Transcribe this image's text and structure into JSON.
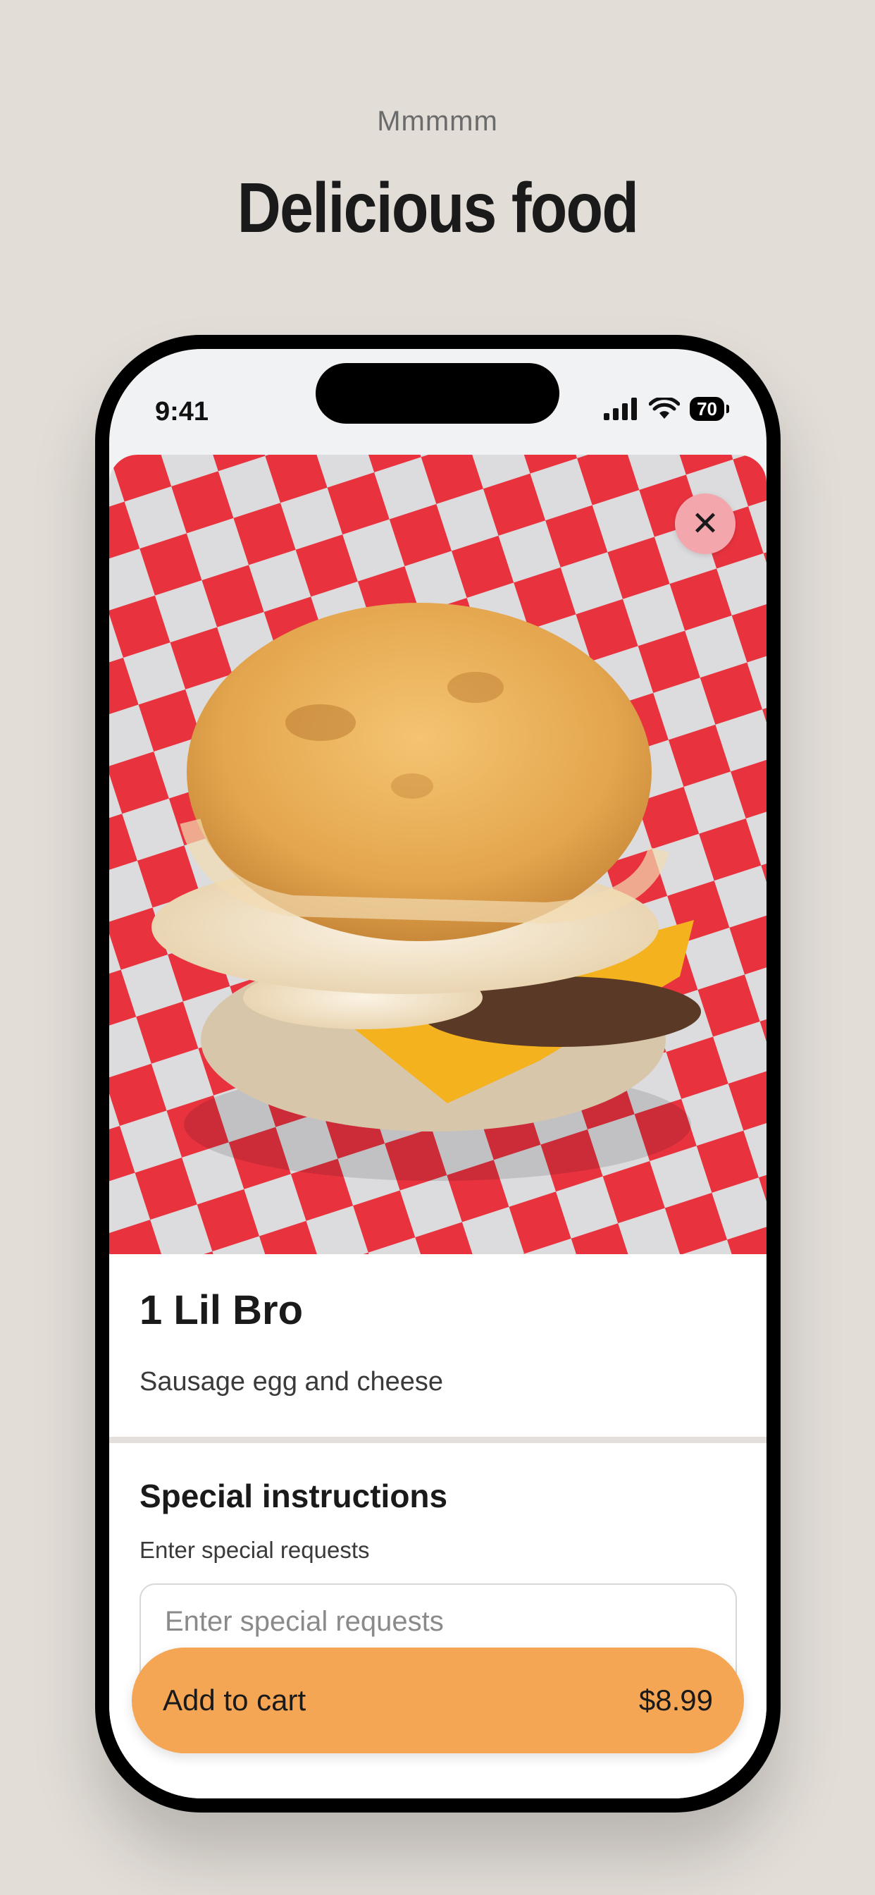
{
  "header": {
    "eyebrow": "Mmmmm",
    "title": "Delicious food"
  },
  "status_bar": {
    "time": "9:41",
    "battery": "70",
    "icons": [
      "signal-icon",
      "wifi-icon",
      "battery-icon"
    ]
  },
  "item": {
    "name": "1 Lil Bro",
    "description": "Sausage egg and cheese",
    "close_icon": "close-icon"
  },
  "instructions": {
    "title": "Special instructions",
    "label": "Enter special requests",
    "placeholder": "Enter special requests"
  },
  "cart": {
    "label": "Add to cart",
    "price": "$8.99"
  },
  "colors": {
    "background": "#e2ddd7",
    "button": "#f4a654",
    "close_button": "#f4a6ad",
    "checker_red": "#e8333f"
  }
}
